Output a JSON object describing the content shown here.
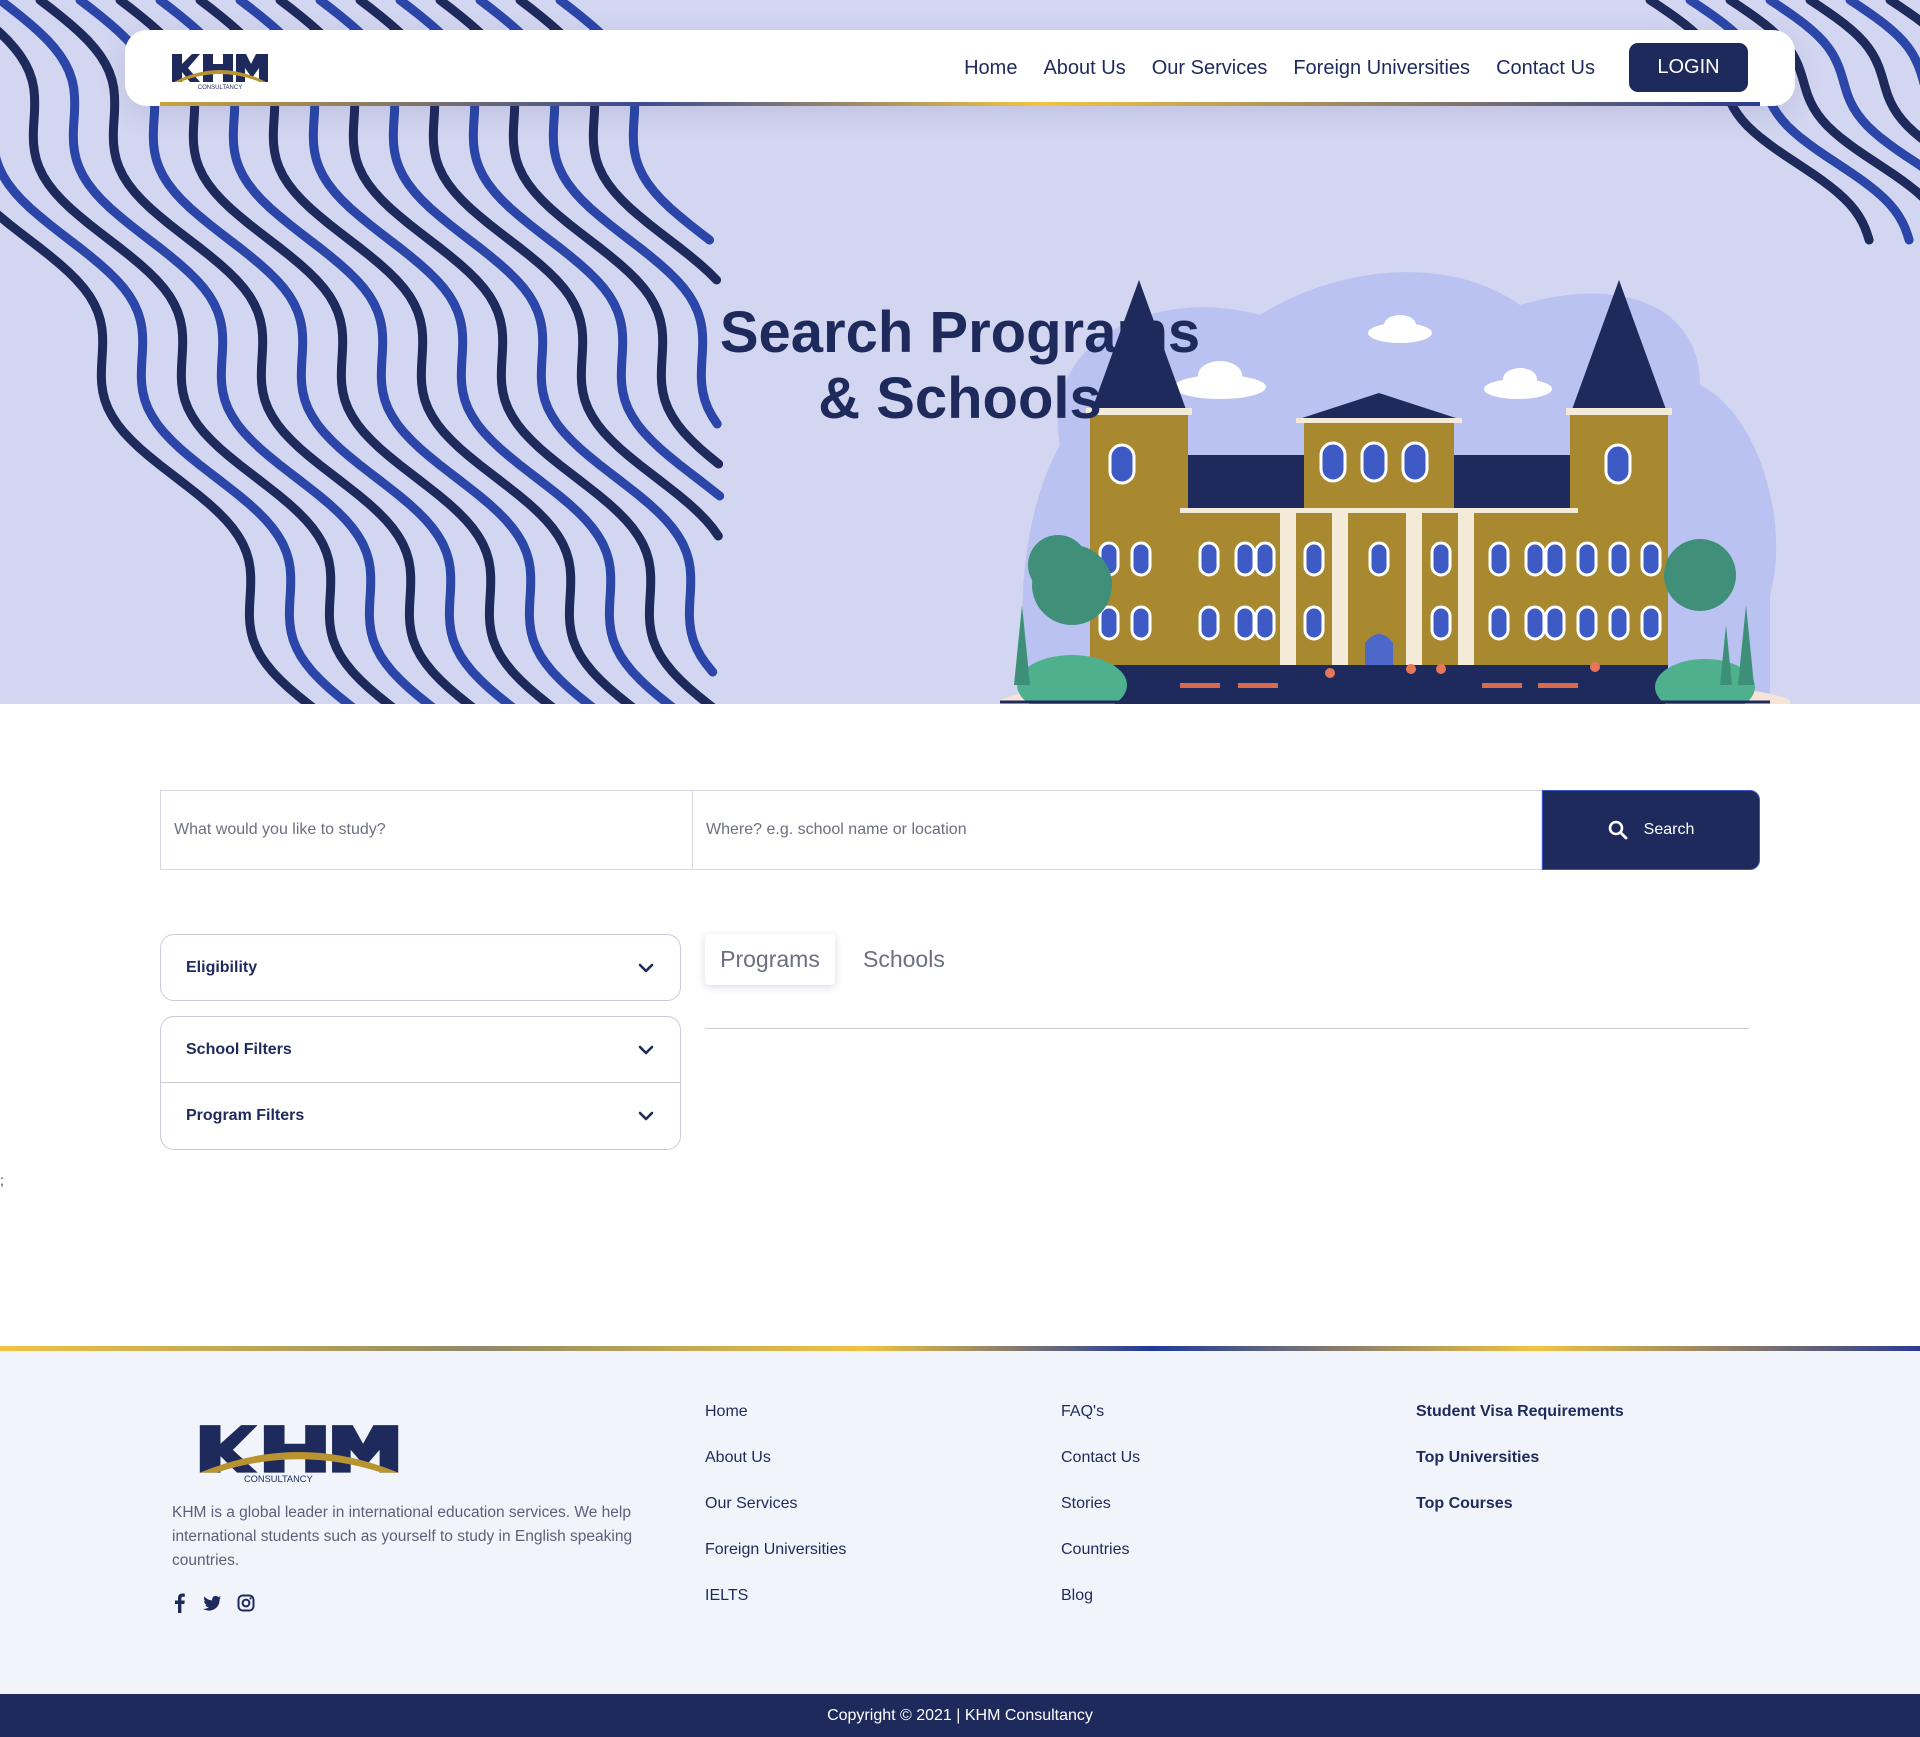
{
  "brand": {
    "logo_text": "KHM",
    "logo_subtext": "CONSULTANCY",
    "primary_color": "#1f2a5c",
    "gold_color": "#c9a23a",
    "hero_bg": "#d3d6f0"
  },
  "nav": {
    "links": [
      "Home",
      "About Us",
      "Our Services",
      "Foreign Universities",
      "Contact Us"
    ],
    "login_label": "LOGIN"
  },
  "hero": {
    "title_line1": "Search Programs",
    "title_line2": "& Schools"
  },
  "search": {
    "study_placeholder": "What would you like to study?",
    "where_placeholder": "Where? e.g. school name or location",
    "button_label": "Search",
    "button_icon": "search-icon"
  },
  "filters": [
    {
      "label": "Eligibility",
      "icon": "chevron-down-icon"
    },
    {
      "label": "School Filters",
      "icon": "chevron-down-icon"
    },
    {
      "label": "Program Filters",
      "icon": "chevron-down-icon"
    }
  ],
  "tabs": {
    "active": "Programs",
    "items": [
      "Programs",
      "Schools"
    ]
  },
  "stray_char": ";",
  "footer": {
    "description": "KHM is a global leader in international education services. We help international students such as yourself to study in English speaking countries.",
    "social_icons": [
      "facebook-icon",
      "twitter-icon",
      "instagram-icon"
    ],
    "col1": [
      "Home",
      "About Us",
      "Our Services",
      "Foreign Universities",
      "IELTS"
    ],
    "col2": [
      "FAQ's",
      "Contact Us",
      "Stories",
      "Countries",
      "Blog"
    ],
    "col3": [
      "Student Visa Requirements",
      "Top Universities",
      "Top Courses"
    ],
    "copyright": "Copyright © 2021 | KHM Consultancy"
  }
}
